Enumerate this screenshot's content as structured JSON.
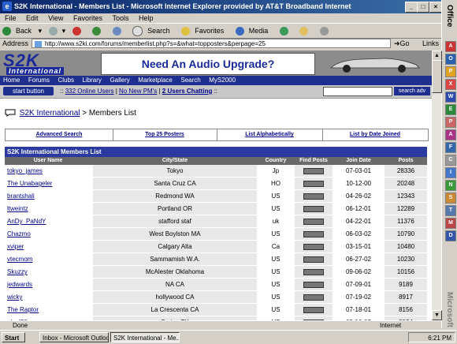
{
  "window": {
    "title": "S2K International - Members List - Microsoft Internet Explorer provided by AT&T Broadband Internet"
  },
  "menu": [
    "File",
    "Edit",
    "View",
    "Favorites",
    "Tools",
    "Help"
  ],
  "toolbar": {
    "back": "Back",
    "search": "Search",
    "favorites": "Favorites",
    "media": "Media"
  },
  "address": {
    "label": "Address",
    "url": "http://www.s2ki.com/forums/memberlist.php?s=&what=topposters&perpage=25",
    "go": "Go",
    "links": "Links"
  },
  "office": {
    "label": "Office",
    "brand": "Microsoft"
  },
  "banner": {
    "logo_main": "S2K",
    "logo_sub": "International",
    "ad_text": "Need An Audio Upgrade?"
  },
  "nav": [
    "Home",
    "Forums",
    "Clubs",
    "Library",
    "Gallery",
    "Marketplace",
    "Search",
    "MyS2000"
  ],
  "statusstrip": {
    "start_button": "start button",
    "online": "332 Online Users",
    "pms": "No New PM's",
    "chatting": "2 Users Chatting",
    "sep": "::",
    "search_adv": "search adv"
  },
  "breadcrumb": {
    "site": "S2K International",
    "sep": ">",
    "page": "Members List"
  },
  "filters": [
    "Advanced Search",
    "Top 25 Posters",
    "List Alphabetically",
    "List by Date Joined"
  ],
  "list": {
    "title": "S2K International Members List",
    "columns": [
      "User Name",
      "City/State",
      "Country",
      "Find Posts",
      "Join Date",
      "Posts"
    ],
    "rows": [
      {
        "user": "tokyo_james",
        "city": "Tokyo",
        "country": "Jp",
        "join": "07-03-01",
        "posts": "28336"
      },
      {
        "user": "The Unabageler",
        "city": "Santa Cruz CA",
        "country": "HO",
        "join": "10-12-00",
        "posts": "20248"
      },
      {
        "user": "brantshali",
        "city": "Redmond WA",
        "country": "US",
        "join": "04-26-02",
        "posts": "12343"
      },
      {
        "user": "ltweintz",
        "city": "Portland OR",
        "country": "US",
        "join": "06-12-01",
        "posts": "12289"
      },
      {
        "user": "AnDy_PaNdY",
        "city": "stafford staf",
        "country": "uk",
        "join": "04-22-01",
        "posts": "11376"
      },
      {
        "user": "Chazmo",
        "city": "West Boylston MA",
        "country": "US",
        "join": "06-03-02",
        "posts": "10790"
      },
      {
        "user": "xviper",
        "city": "Calgary Alta",
        "country": "Ca",
        "join": "03-15-01",
        "posts": "10480"
      },
      {
        "user": "vtecmom",
        "city": "Sammamish W.A.",
        "country": "US",
        "join": "06-27-02",
        "posts": "10230"
      },
      {
        "user": "Skuzzy",
        "city": "McAlester Oklahoma",
        "country": "US",
        "join": "09-06-02",
        "posts": "10156"
      },
      {
        "user": "jedwards",
        "city": "NA CA",
        "country": "US",
        "join": "07-09-01",
        "posts": "9189"
      },
      {
        "user": "wicky",
        "city": "hollywood CA",
        "country": "US",
        "join": "07-19-02",
        "posts": "8917"
      },
      {
        "user": "The Raptor",
        "city": "La Crescenta CA",
        "country": "US",
        "join": "07-18-01",
        "posts": "8156"
      },
      {
        "user": "alexf20c",
        "city": "Spring TX",
        "country": "US",
        "join": "08-10-02",
        "posts": "8024"
      }
    ]
  },
  "iestatus": {
    "done": "Done",
    "zone": "Internet"
  },
  "taskbar": {
    "start": "Start",
    "inbox": "Inbox - Microsoft Outlook",
    "ie": "S2K International - Me...",
    "clock": "6:21 PM"
  }
}
